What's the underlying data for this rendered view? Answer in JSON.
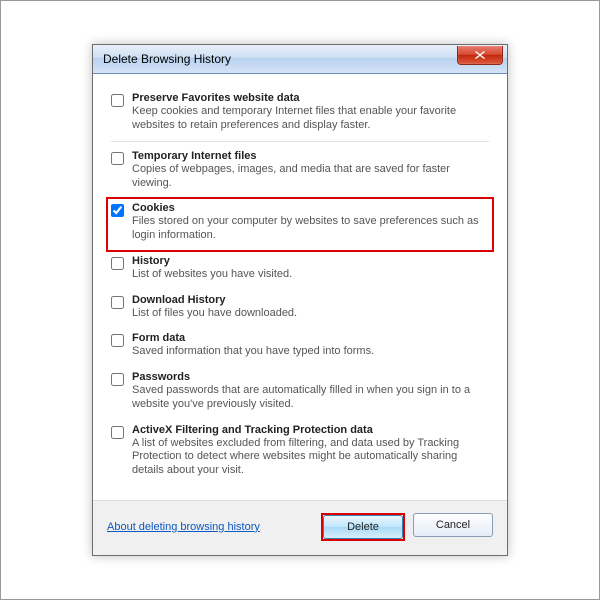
{
  "title": "Delete Browsing History",
  "options": [
    {
      "label": "Preserve Favorites website data",
      "desc": "Keep cookies and temporary Internet files that enable your favorite websites to retain preferences and display faster.",
      "checked": false,
      "sep": true,
      "highlight": false
    },
    {
      "label": "Temporary Internet files",
      "desc": "Copies of webpages, images, and media that are saved for faster viewing.",
      "checked": false,
      "sep": false,
      "highlight": false
    },
    {
      "label": "Cookies",
      "desc": "Files stored on your computer by websites to save preferences such as login information.",
      "checked": true,
      "sep": false,
      "highlight": true
    },
    {
      "label": "History",
      "desc": "List of websites you have visited.",
      "checked": false,
      "sep": false,
      "highlight": false
    },
    {
      "label": "Download History",
      "desc": "List of files you have downloaded.",
      "checked": false,
      "sep": false,
      "highlight": false
    },
    {
      "label": "Form data",
      "desc": "Saved information that you have typed into forms.",
      "checked": false,
      "sep": false,
      "highlight": false
    },
    {
      "label": "Passwords",
      "desc": "Saved passwords that are automatically filled in when you sign in to a website you've previously visited.",
      "checked": false,
      "sep": false,
      "highlight": false
    },
    {
      "label": "ActiveX Filtering and Tracking Protection data",
      "desc": "A list of websites excluded from filtering, and data used by Tracking Protection to detect where websites might be automatically sharing details about your visit.",
      "checked": false,
      "sep": false,
      "highlight": false
    }
  ],
  "link": "About deleting browsing history",
  "buttons": {
    "delete": "Delete",
    "cancel": "Cancel"
  }
}
